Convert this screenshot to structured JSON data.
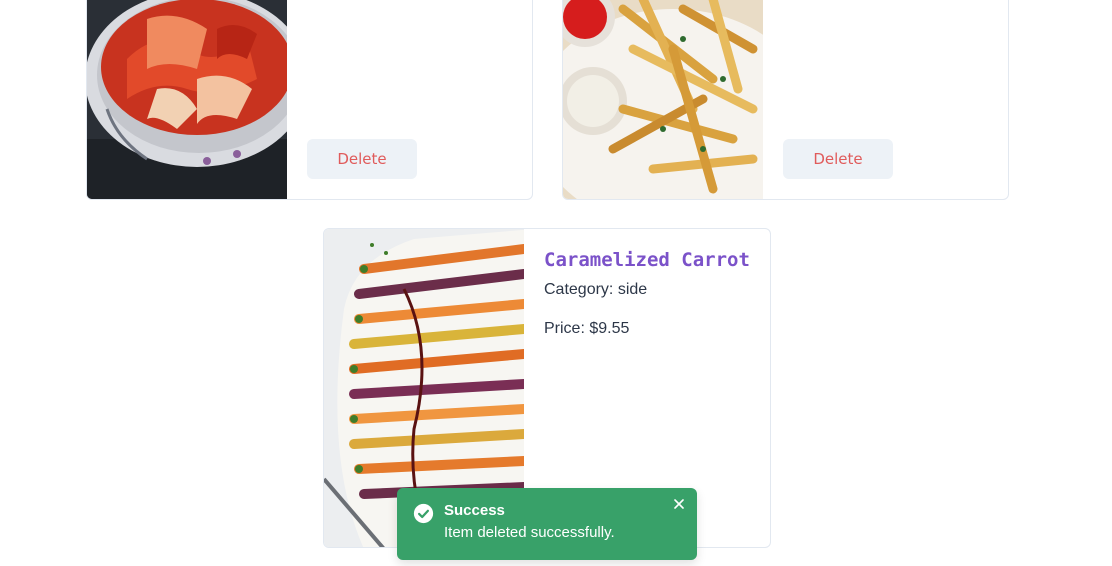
{
  "cards_top": [
    {
      "image_icon": "kimchi-photo",
      "delete_label": "Delete"
    },
    {
      "image_icon": "fries-photo",
      "delete_label": "Delete"
    }
  ],
  "card_center": {
    "image_icon": "carrot-photo",
    "title": "Caramelized Carrot",
    "category": "Category: side",
    "price": "Price: $9.55"
  },
  "toast": {
    "icon": "check-circle-icon",
    "title": "Success",
    "description": "Item deleted successfully.",
    "close_icon": "close-icon"
  },
  "colors": {
    "accent_title": "#7b52c9",
    "delete_text": "#e05b5b",
    "delete_bg": "#edf2f7",
    "toast_bg": "#38a169",
    "card_border": "#e2e8f0"
  }
}
